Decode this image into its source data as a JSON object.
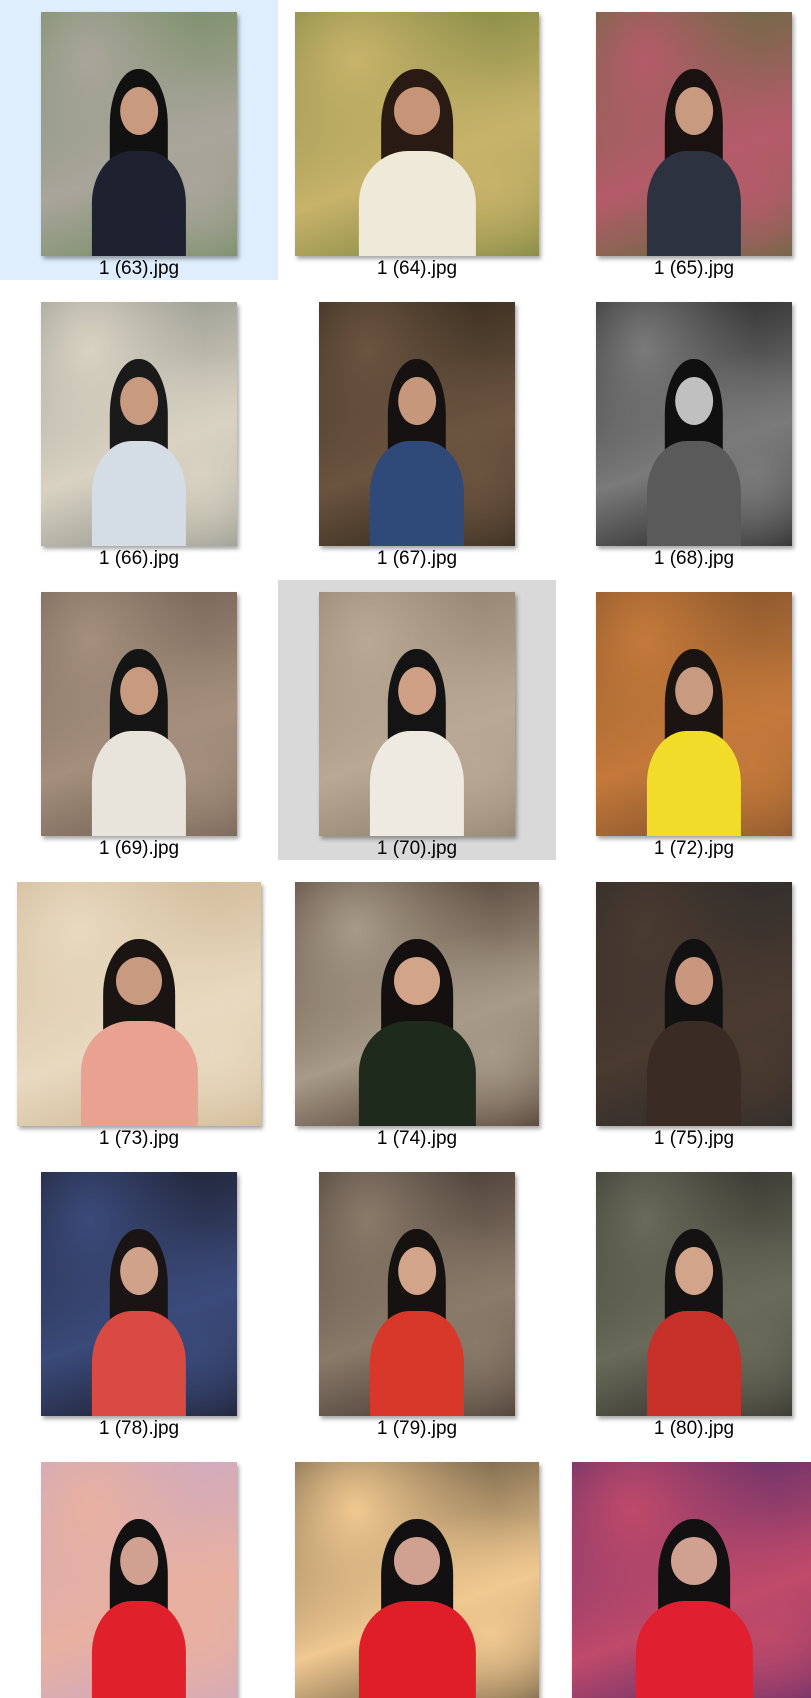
{
  "items": [
    {
      "name": "1 (63).jpg",
      "state": "selected",
      "orientation": "portrait",
      "colors": [
        "#6f8a5c",
        "#a9a59b",
        "#1e2230",
        "#c89a80",
        "#111111"
      ]
    },
    {
      "name": "1 (64).jpg",
      "state": "normal",
      "orientation": "landscape",
      "colors": [
        "#6e7d3a",
        "#c8b36a",
        "#eee9d8",
        "#c69477",
        "#2a1a14"
      ]
    },
    {
      "name": "1 (65).jpg",
      "state": "normal",
      "orientation": "portrait",
      "colors": [
        "#5a6f3a",
        "#b55b6a",
        "#2d3240",
        "#c89a80",
        "#1a1210"
      ]
    },
    {
      "name": "1 (66).jpg",
      "state": "normal",
      "orientation": "portrait",
      "colors": [
        "#8a8f86",
        "#d9d2c2",
        "#d4dce6",
        "#c89a80",
        "#1a1a1a"
      ]
    },
    {
      "name": "1 (67).jpg",
      "state": "normal",
      "orientation": "portrait",
      "colors": [
        "#2d2418",
        "#6b5440",
        "#2f4a78",
        "#c7977c",
        "#161211"
      ]
    },
    {
      "name": "1 (68).jpg",
      "state": "normal",
      "orientation": "portrait",
      "colors": [
        "#1c1c1c",
        "#7a7a7a",
        "#5a5a5a",
        "#c0c0c0",
        "#101010"
      ]
    },
    {
      "name": "1 (69).jpg",
      "state": "normal",
      "orientation": "portrait",
      "colors": [
        "#6b5a4c",
        "#a48f7d",
        "#e8e4dc",
        "#c89a80",
        "#151515"
      ]
    },
    {
      "name": "1 (70).jpg",
      "state": "hover",
      "orientation": "portrait",
      "colors": [
        "#8a7a66",
        "#b8a894",
        "#eeeae2",
        "#cf9f86",
        "#141414"
      ]
    },
    {
      "name": "1 (72).jpg",
      "state": "normal",
      "orientation": "portrait",
      "colors": [
        "#7a4e2a",
        "#c4793a",
        "#f1dc2a",
        "#c89a80",
        "#1c1410"
      ]
    },
    {
      "name": "1 (73).jpg",
      "state": "normal",
      "orientation": "landscape",
      "colors": [
        "#c9b08a",
        "#e8d9c0",
        "#e9a292",
        "#c89a80",
        "#1a1412"
      ]
    },
    {
      "name": "1 (74).jpg",
      "state": "normal",
      "orientation": "landscape",
      "colors": [
        "#3a2a20",
        "#a89a88",
        "#1e2a1c",
        "#d2a48a",
        "#141010"
      ]
    },
    {
      "name": "1 (75).jpg",
      "state": "normal",
      "orientation": "portrait",
      "colors": [
        "#2a2a2a",
        "#4a3a30",
        "#3a2c24",
        "#c8977e",
        "#121212"
      ]
    },
    {
      "name": "1 (78).jpg",
      "state": "normal",
      "orientation": "portrait",
      "colors": [
        "#1a1a24",
        "#3a4a7a",
        "#d84a42",
        "#d0a28a",
        "#1a1414"
      ]
    },
    {
      "name": "1 (79).jpg",
      "state": "normal",
      "orientation": "portrait",
      "colors": [
        "#3a3028",
        "#8a7a6a",
        "#d8382a",
        "#d2a48a",
        "#161210"
      ]
    },
    {
      "name": "1 (80).jpg",
      "state": "normal",
      "orientation": "portrait",
      "colors": [
        "#2a2a26",
        "#6a6a5a",
        "#c8302a",
        "#d2a48a",
        "#141212"
      ]
    },
    {
      "name": "",
      "state": "normal",
      "orientation": "portrait",
      "colors": [
        "#c8a8c8",
        "#e8b0a0",
        "#e0202a",
        "#d0a090",
        "#121010"
      ]
    },
    {
      "name": "",
      "state": "normal",
      "orientation": "landscape",
      "colors": [
        "#4a4030",
        "#f0c890",
        "#e01e28",
        "#d0a090",
        "#121010"
      ]
    },
    {
      "name": "",
      "state": "normal",
      "orientation": "landscape",
      "colors": [
        "#4a2a6a",
        "#c04a6a",
        "#e02030",
        "#d0a090",
        "#121010"
      ]
    }
  ]
}
